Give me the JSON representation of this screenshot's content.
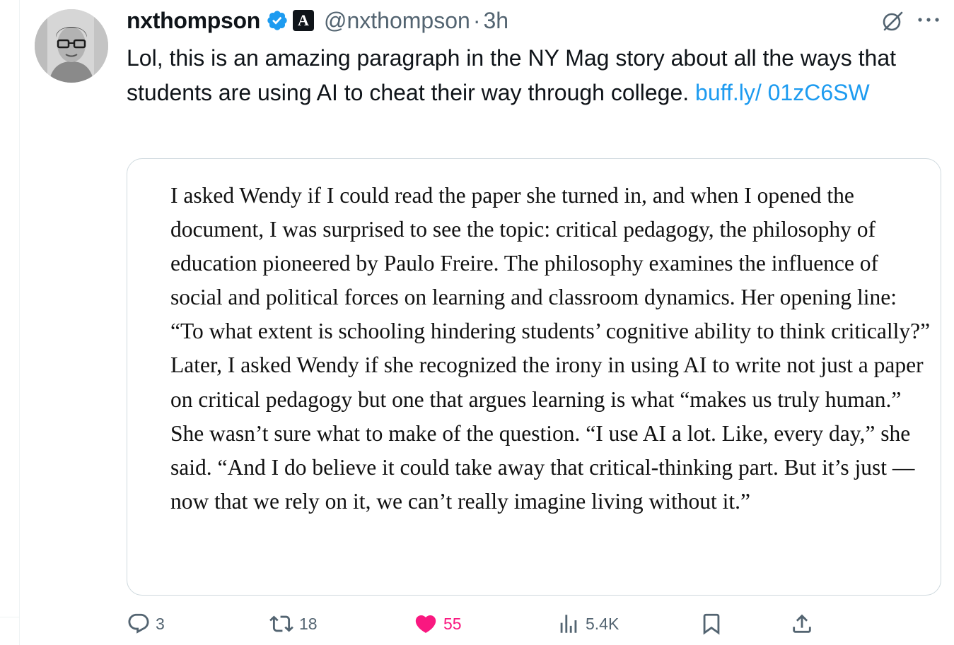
{
  "author": {
    "display_name": "nxthompson",
    "handle": "@nxthompson",
    "separator": "·",
    "time": "3h",
    "affiliate_badge_letter": "A"
  },
  "icons": {
    "verified": "verified-badge-icon",
    "affiliate": "affiliate-badge-icon",
    "grok": "grok-icon",
    "more": "more-icon",
    "reply": "reply-icon",
    "repost": "repost-icon",
    "like": "like-icon",
    "views": "views-icon",
    "bookmark": "bookmark-icon",
    "share": "share-icon"
  },
  "tweet": {
    "text": "Lol, this is an amazing paragraph in the NY Mag story about all the ways that students are using AI to cheat their way through college. ",
    "link_text": "buff.ly/ 01zC6SW"
  },
  "media": {
    "quote_text": "I asked Wendy if I could read the paper she turned in, and when I opened the document, I was surprised to see the topic: critical pedagogy, the philosophy of education pioneered by Paulo Freire. The philosophy examines the influence of social and political forces on learning and classroom dynamics. Her opening line: “To what extent is schooling hindering students’ cognitive ability to think critically?” Later, I asked Wendy if she recognized the irony in using AI to write not just a paper on critical pedagogy but one that argues learning is what “makes us truly human.” She wasn’t sure what to make of the question. “I use AI a lot. Like, every day,” she said. “And I do believe it could take away that critical-thinking part. But it’s just — now that we rely on it, we can’t really imagine living without it.”"
  },
  "actions": {
    "replies": "3",
    "reposts": "18",
    "likes": "55",
    "views": "5.4K"
  },
  "colors": {
    "accent": "#1d9bf0",
    "like": "#f91880",
    "muted": "#536471",
    "text": "#0f1419",
    "border": "#cfd9de"
  }
}
